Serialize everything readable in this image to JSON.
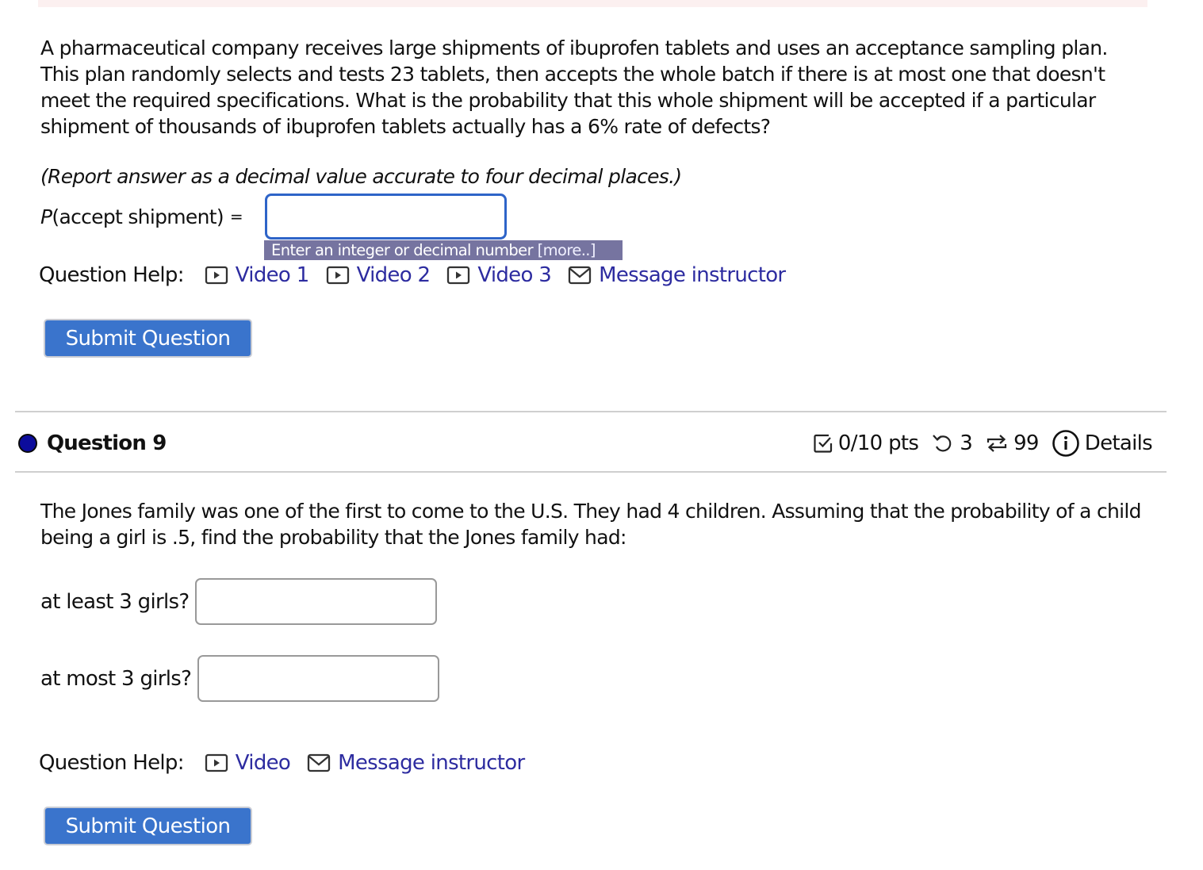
{
  "question8": {
    "problem_text": "A pharmaceutical company receives large shipments of ibuprofen tablets and uses an acceptance sampling plan. This plan randomly selects and tests 23 tablets, then accepts the whole batch if there is at most one that doesn't meet the required specifications. What is the probability that this whole shipment will be accepted if a particular shipment of thousands of ibuprofen tablets actually has a 6% rate of defects?",
    "instruction": "(Report answer as a decimal value accurate to four decimal places.)",
    "answer_label_p": "P",
    "answer_label_rest": "(accept shipment)",
    "answer_equals": "=",
    "answer_value": "",
    "tooltip_text": "Enter an integer or decimal number ",
    "tooltip_more": "[more..]",
    "help_label": "Question Help:",
    "help_links": [
      {
        "icon": "video-play-icon",
        "label": "Video 1"
      },
      {
        "icon": "video-play-icon",
        "label": "Video 2"
      },
      {
        "icon": "video-play-icon",
        "label": "Video 3"
      },
      {
        "icon": "envelope-icon",
        "label": "Message instructor"
      }
    ],
    "submit_label": "Submit Question"
  },
  "question9": {
    "title": "Question 9",
    "status_color": "#0c0c9c",
    "points": "0/10 pts",
    "retries": "3",
    "attempts": "99",
    "details_label": "Details",
    "problem_text": "The Jones family was one of the first to come to the U.S. They had 4 children. Assuming that the probability of a child being a girl is .5, find the probability that the Jones family had:",
    "parts": [
      {
        "label": "at least 3 girls?",
        "value": ""
      },
      {
        "label": "at most 3 girls?",
        "value": ""
      }
    ],
    "help_label": "Question Help:",
    "help_links": [
      {
        "icon": "video-play-icon",
        "label": "Video"
      },
      {
        "icon": "envelope-icon",
        "label": "Message instructor"
      }
    ],
    "submit_label": "Submit Question"
  },
  "colors": {
    "link": "#2d2ca0",
    "button": "#3a74cc",
    "focus_border": "#2e64c8",
    "tooltip_bg": "#7674a0"
  }
}
